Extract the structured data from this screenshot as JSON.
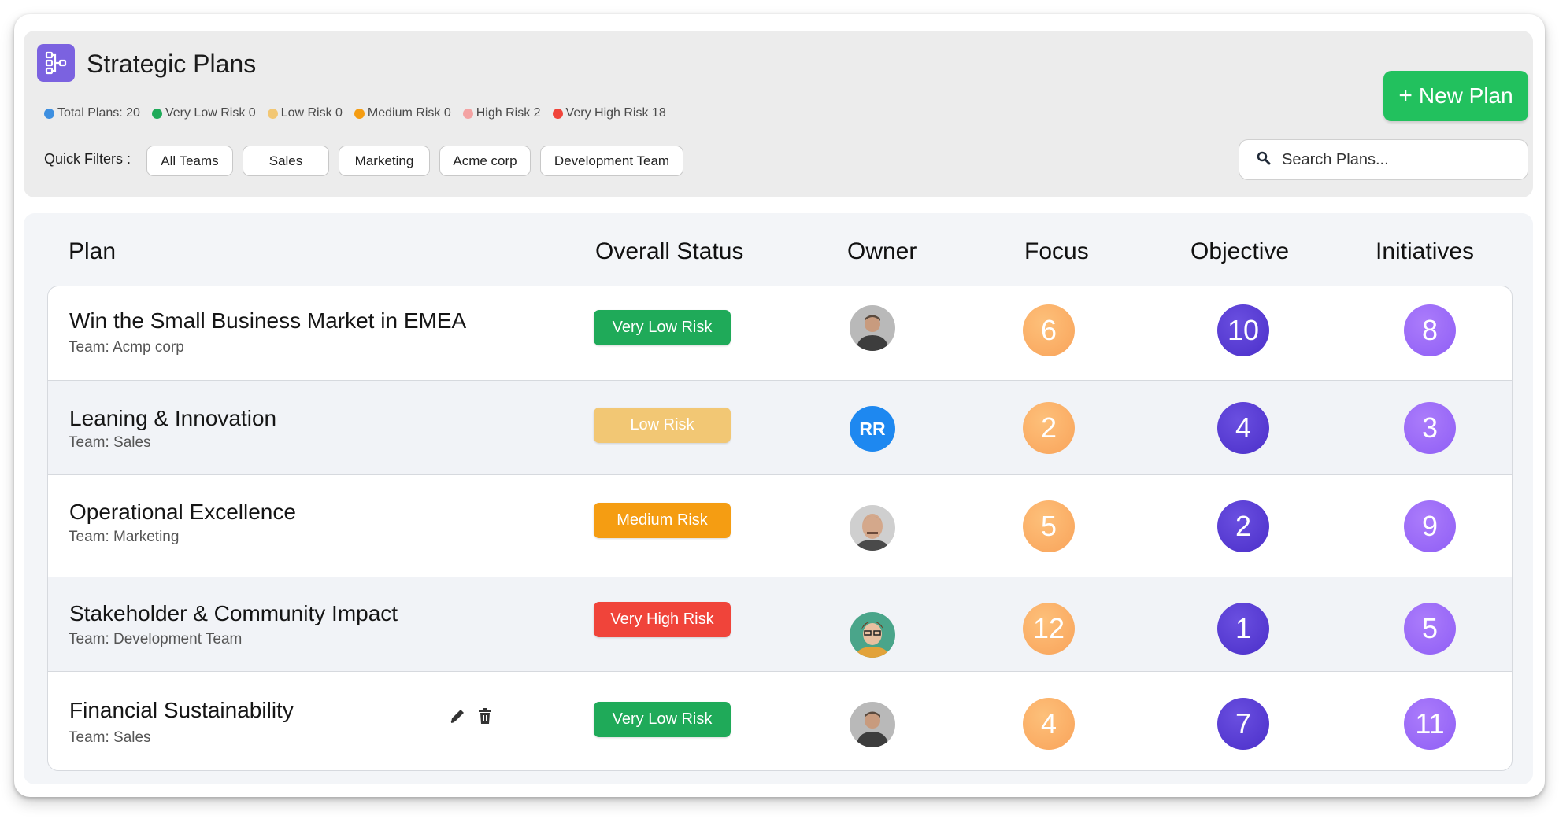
{
  "header": {
    "title": "Strategic Plans",
    "icon": "hierarchy-icon",
    "new_plan_label": "New Plan",
    "search_placeholder": "Search Plans...",
    "quick_filters_label": "Quick Filters :",
    "quick_filters": [
      "All Teams",
      "Sales",
      "Marketing",
      "Acme corp",
      "Development Team"
    ],
    "stats": [
      {
        "label": "Total Plans: 20",
        "color": "#3d8fe0"
      },
      {
        "label": "Very Low Risk 0",
        "color": "#1faa59"
      },
      {
        "label": "Low Risk 0",
        "color": "#f2c774"
      },
      {
        "label": "Medium Risk 0",
        "color": "#f59d12"
      },
      {
        "label": "High Risk 2",
        "color": "#f4a3a3"
      },
      {
        "label": "Very High Risk 18",
        "color": "#f0443a"
      }
    ]
  },
  "table": {
    "columns": [
      "Plan",
      "Overall Status",
      "Owner",
      "Focus",
      "Objective",
      "Initiatives"
    ],
    "rows": [
      {
        "name": "Win the Small Business Market in EMEA",
        "team": "Team: Acmp corp",
        "status": "Very Low Risk",
        "status_color": "#1faa59",
        "owner": "photo",
        "owner_initials": "",
        "focus": "6",
        "objective": "10",
        "initiatives": "8"
      },
      {
        "name": "Leaning & Innovation",
        "team": "Team: Sales",
        "status": "Low Risk",
        "status_color": "#f2c774",
        "owner": "initials",
        "owner_initials": "RR",
        "focus": "2",
        "objective": "4",
        "initiatives": "3"
      },
      {
        "name": "Operational Excellence",
        "team": "Team: Marketing",
        "status": "Medium Risk",
        "status_color": "#f59d12",
        "owner": "photo",
        "owner_initials": "",
        "focus": "5",
        "objective": "2",
        "initiatives": "9"
      },
      {
        "name": "Stakeholder & Community Impact",
        "team": "Team: Development Team",
        "status": "Very High Risk",
        "status_color": "#f0443a",
        "owner": "photo",
        "owner_initials": "",
        "focus": "12",
        "objective": "1",
        "initiatives": "5"
      },
      {
        "name": "Financial Sustainability",
        "team": "Team: Sales",
        "status": "Very Low Risk",
        "status_color": "#1faa59",
        "owner": "photo",
        "owner_initials": "",
        "focus": "4",
        "objective": "7",
        "initiatives": "11"
      }
    ],
    "row_action_icons": [
      "edit-icon",
      "delete-icon"
    ]
  }
}
